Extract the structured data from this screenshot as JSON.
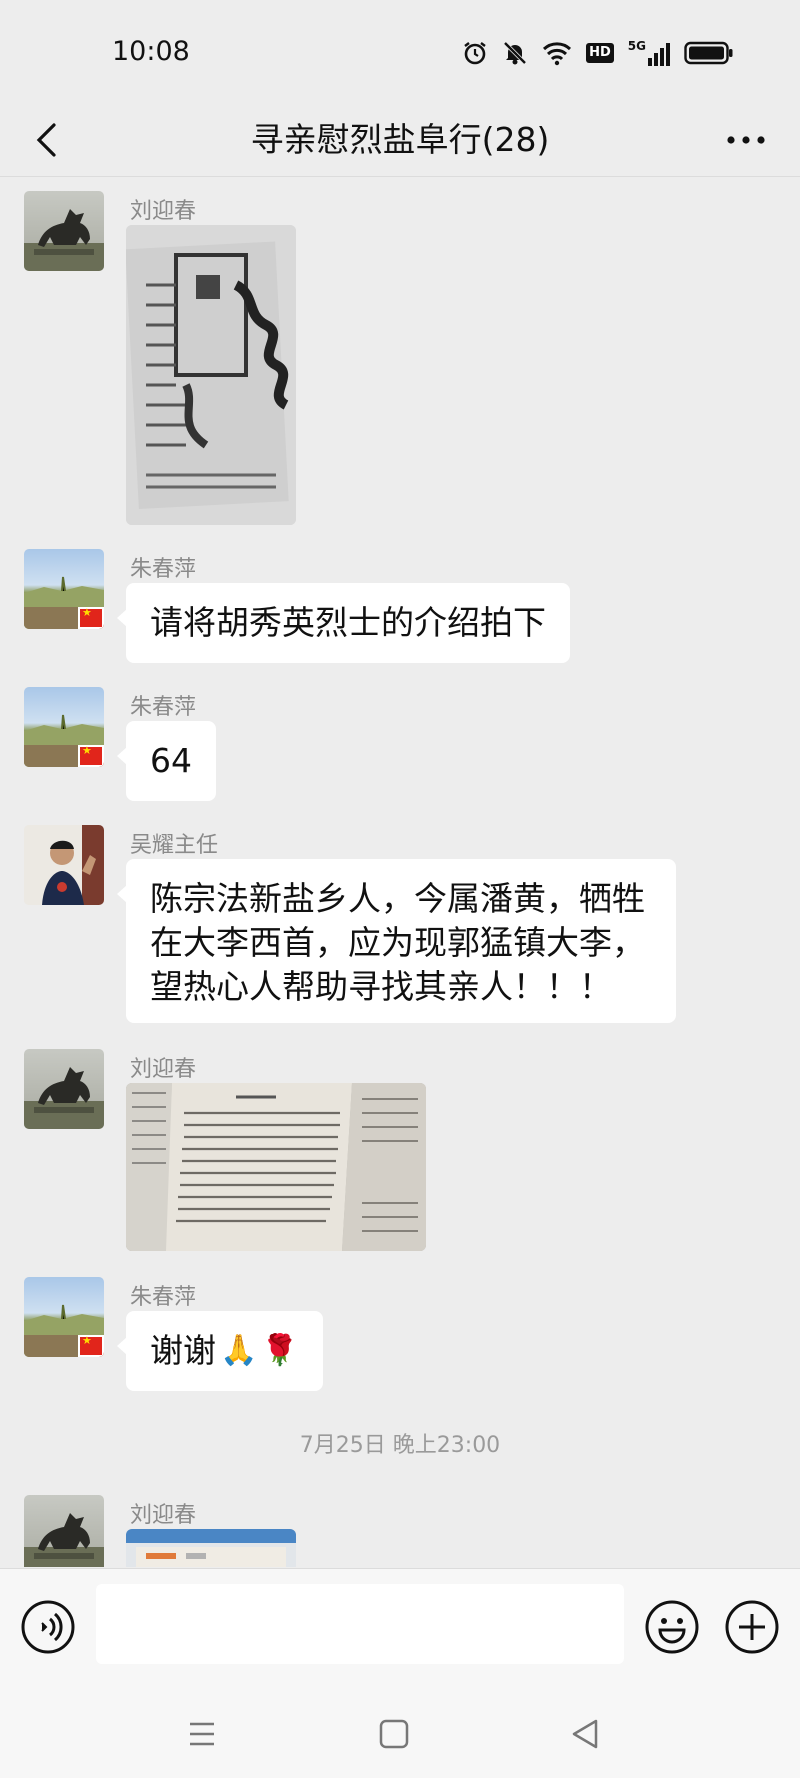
{
  "status": {
    "time": "10:08",
    "icons": [
      "alarm-icon",
      "mute-bell-icon",
      "wifi-icon",
      "hd-icon",
      "5g-signal-icon",
      "battery-icon"
    ],
    "hd_text": "HD",
    "net_text": "5G"
  },
  "header": {
    "title": "寻亲慰烈盐阜行(28)",
    "back_icon": "back-chevron-icon",
    "more_icon": "more-dots-icon"
  },
  "messages": [
    {
      "sender": "刘迎春",
      "type": "image",
      "image": "document-photo"
    },
    {
      "sender": "朱春萍",
      "type": "text",
      "text": "请将胡秀英烈士的介绍拍下"
    },
    {
      "sender": "朱春萍",
      "type": "text",
      "text": "64"
    },
    {
      "sender": "吴耀主任",
      "type": "text",
      "lines": [
        "陈宗法新盐乡人，今属潘黄，牺牲",
        "在大李西首，应为现郭猛镇大李，",
        "望热心人帮助寻找其亲人！！！"
      ]
    },
    {
      "sender": "刘迎春",
      "type": "image",
      "image": "book-page-photo"
    },
    {
      "sender": "朱春萍",
      "type": "text",
      "text": "谢谢",
      "emoji": [
        "🙏",
        "🌹"
      ]
    },
    {
      "sender": "刘迎春",
      "type": "image",
      "image": "book-photo-partial"
    }
  ],
  "time_divider": "7月25日 晚上23:00",
  "input": {
    "value": "",
    "placeholder": ""
  },
  "colors": {
    "background": "#ededed",
    "bubble": "#ffffff",
    "sender_name": "#8a8a8a"
  }
}
